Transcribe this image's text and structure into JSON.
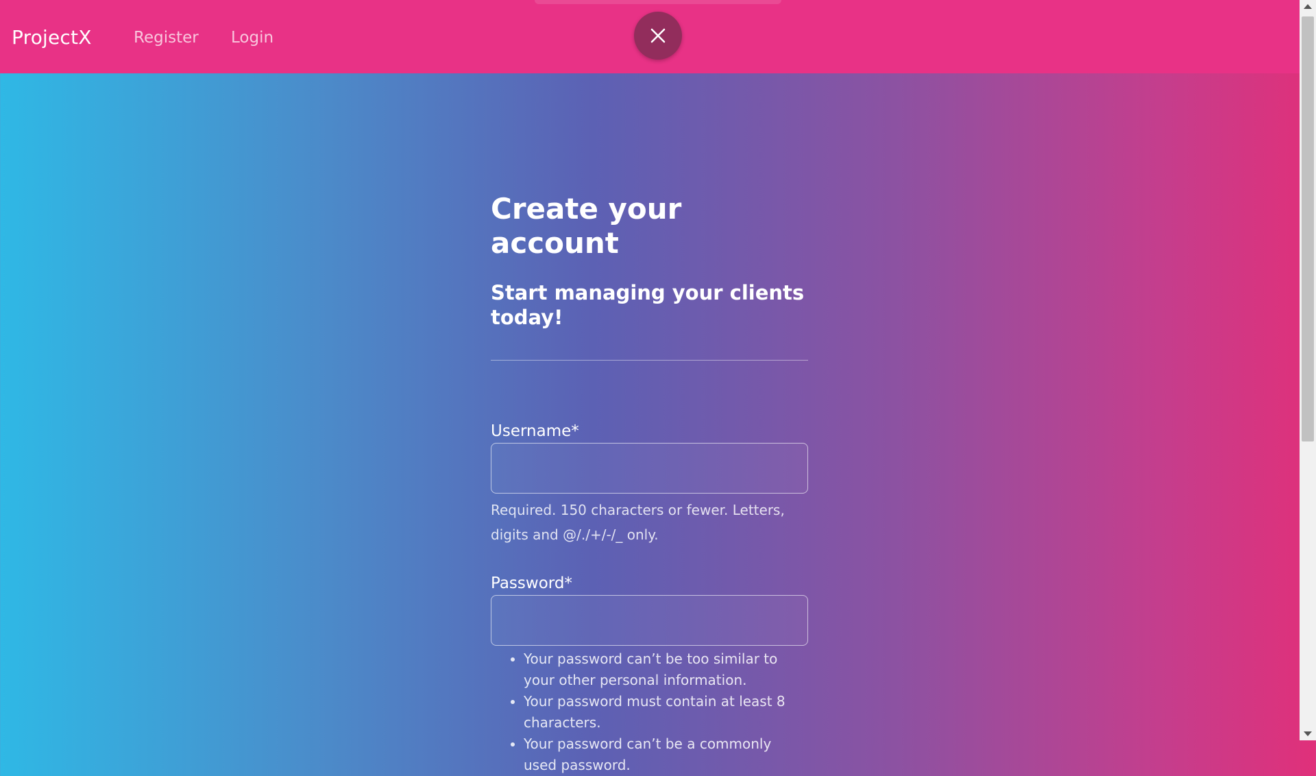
{
  "navbar": {
    "brand": "ProjectX",
    "links": [
      {
        "label": "Register"
      },
      {
        "label": "Login"
      }
    ],
    "close_icon": "close-icon",
    "background": "#e83286"
  },
  "form": {
    "title": "Create your account",
    "subtitle": "Start managing your clients today!",
    "username": {
      "label": "Username*",
      "value": "",
      "help": "Required. 150 characters or fewer. Letters, digits and @/./+/-/_ only."
    },
    "password": {
      "label": "Password*",
      "value": "",
      "rules": [
        "Your password can’t be too similar to your other personal information.",
        "Your password must contain at least 8 characters.",
        "Your password can’t be a commonly used password."
      ]
    }
  },
  "colors": {
    "gradient_start": "#2fb8e5",
    "gradient_end": "#e0307a",
    "close_button": "#922d5c"
  }
}
